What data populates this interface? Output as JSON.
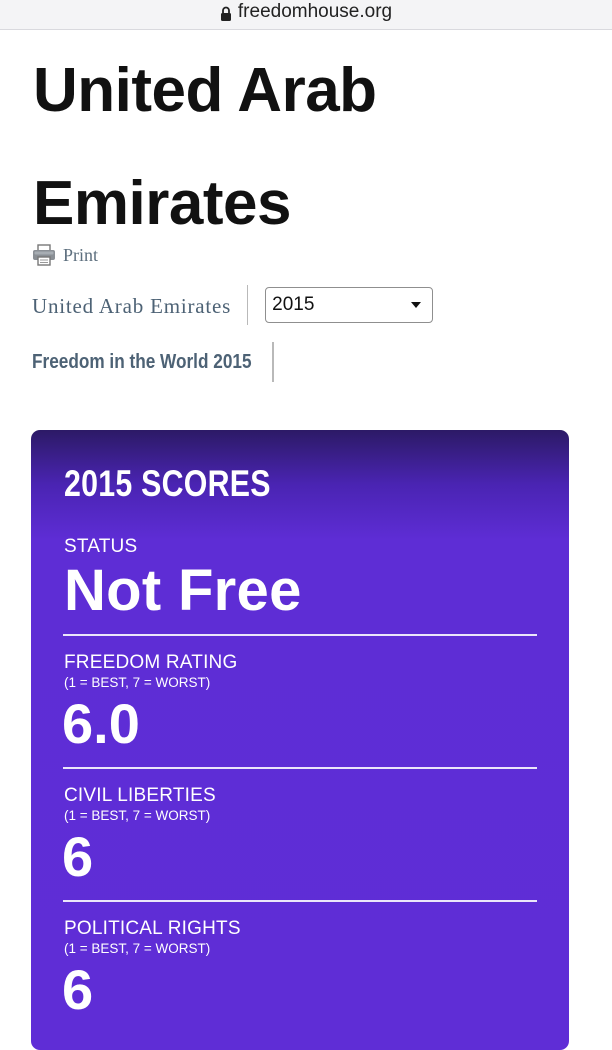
{
  "browser": {
    "url": "freedomhouse.org"
  },
  "page": {
    "title_line1": "United Arab",
    "title_line2": "Emirates",
    "print_label": "Print"
  },
  "filters": {
    "country": "United Arab Emirates",
    "year_selected": "2015",
    "edition_title": "Freedom in the World 2015"
  },
  "scores": {
    "heading": "2015 SCORES",
    "status_label": "STATUS",
    "status_value": "Not Free",
    "freedom_rating_label": "FREEDOM RATING",
    "freedom_rating_scale": "(1 = BEST, 7 = WORST)",
    "freedom_rating_value": "6.0",
    "civil_liberties_label": "CIVIL LIBERTIES",
    "civil_liberties_scale": "(1 = BEST, 7 = WORST)",
    "civil_liberties_value": "6",
    "political_rights_label": "POLITICAL RIGHTS",
    "political_rights_scale": "(1 = BEST, 7 = WORST)",
    "political_rights_value": "6"
  },
  "colors": {
    "card_top": "#2c1a66",
    "card_main": "#5f2dd6",
    "muted_blue_text": "#4d6275"
  },
  "icons": {
    "lock": "lock-icon",
    "print": "printer-icon",
    "dropdown": "chevron-down-icon"
  }
}
